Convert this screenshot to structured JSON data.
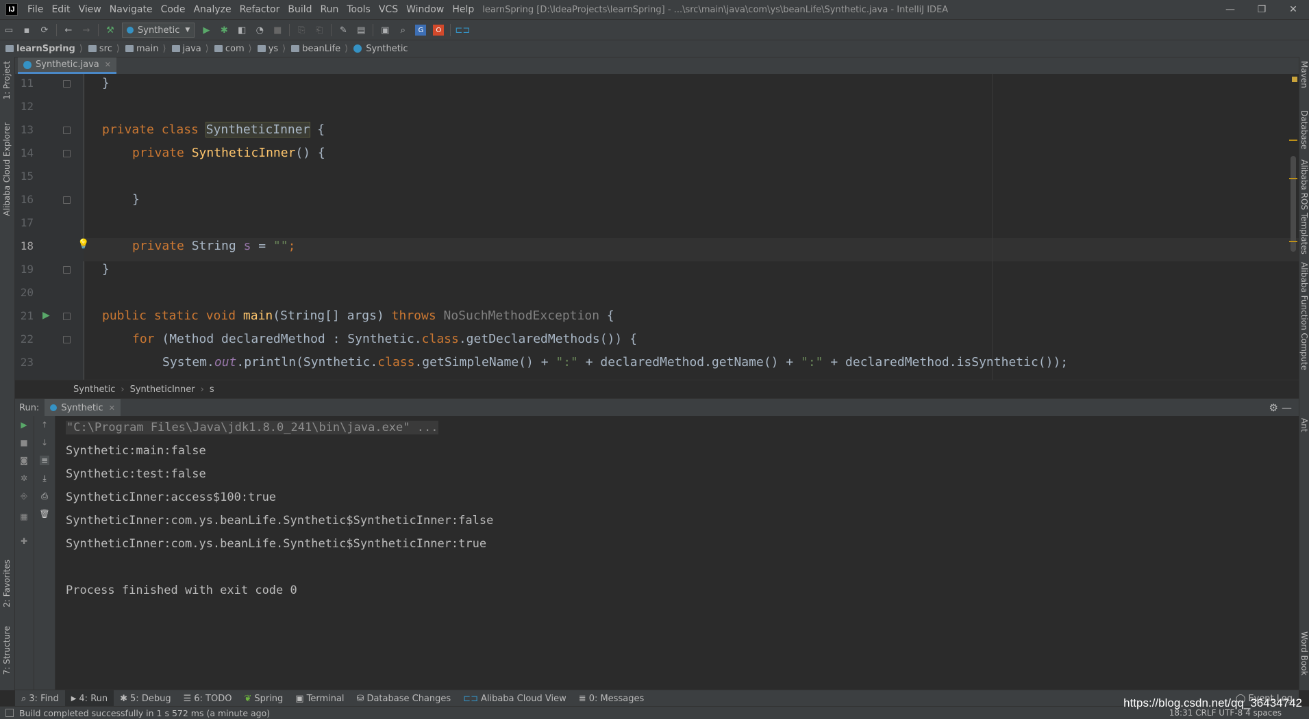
{
  "window": {
    "app_icon": "IJ",
    "menu": [
      "File",
      "Edit",
      "View",
      "Navigate",
      "Code",
      "Analyze",
      "Refactor",
      "Build",
      "Run",
      "Tools",
      "VCS",
      "Window",
      "Help"
    ],
    "title": "learnSpring [D:\\IdeaProjects\\learnSpring] - ...\\src\\main\\java\\com\\ys\\beanLife\\Synthetic.java - IntelliJ IDEA",
    "controls": [
      "—",
      "❐",
      "✕"
    ]
  },
  "toolbar": {
    "run_config": "Synthetic",
    "icons": [
      "open-icon",
      "save-icon",
      "sync-icon",
      "back-icon",
      "forward-icon",
      "build-icon",
      "run-icon",
      "debug-icon",
      "coverage-icon",
      "profile-icon",
      "stop-icon",
      "search-icon"
    ]
  },
  "breadcrumb": [
    "learnSpring",
    "src",
    "main",
    "java",
    "com",
    "ys",
    "beanLife",
    "Synthetic"
  ],
  "left_stripe": {
    "project": "1: Project",
    "cloud": "Alibaba Cloud Explorer",
    "favorites": "2: Favorites",
    "structure": "7: Structure"
  },
  "right_stripe": {
    "maven": "Maven",
    "database": "Database",
    "ros": "Alibaba ROS Templates",
    "function": "Alibaba Function Compute",
    "ant": "Ant",
    "wordbook": "Word Book"
  },
  "editor": {
    "tab": "Synthetic.java",
    "line_numbers": [
      "11",
      "12",
      "13",
      "14",
      "15",
      "16",
      "17",
      "18",
      "19",
      "20",
      "21",
      "22",
      "23"
    ]
  },
  "code": {
    "l11": "}",
    "l13_kw": "private class ",
    "l13_name": "SyntheticInner",
    "l13_rest": " {",
    "l14_kw": "private ",
    "l14_fn": "SyntheticInner",
    "l14_rest": "() {",
    "l16": "}",
    "l18_kw": "private ",
    "l18_type": "String ",
    "l18_var": "s",
    "l18_eq": " = ",
    "l18_str": "\"\"",
    "l18_end": ";",
    "l19": "}",
    "l21_kw": "public static void ",
    "l21_fn": "main",
    "l21_args": "(String[] args) ",
    "l21_throws": "throws ",
    "l21_exc": "NoSuchMethodException",
    "l21_end": " {",
    "l22_for": "for ",
    "l22_a": "(Method declaredMethod : Synthetic.",
    "l22_class": "class",
    "l22_b": ".getDeclaredMethods()) {",
    "l23_a": "System.",
    "l23_out": "out",
    "l23_b": ".println(Synthetic.",
    "l23_class": "class",
    "l23_c": ".getSimpleName() + ",
    "l23_s1": "\":\"",
    "l23_d": " + declaredMethod.getName() + ",
    "l23_s2": "\":\"",
    "l23_e": " + declaredMethod.isSynthetic());"
  },
  "editor_crumb": [
    "Synthetic",
    "SyntheticInner",
    "s"
  ],
  "run": {
    "label": "Run:",
    "tab": "Synthetic",
    "output": [
      "\"C:\\Program Files\\Java\\jdk1.8.0_241\\bin\\java.exe\" ...",
      "Synthetic:main:false",
      "Synthetic:test:false",
      "SyntheticInner:access$100:true",
      "SyntheticInner:com.ys.beanLife.Synthetic$SyntheticInner:false",
      "SyntheticInner:com.ys.beanLife.Synthetic$SyntheticInner:true",
      "",
      "Process finished with exit code 0"
    ]
  },
  "bottom_tabs": [
    "3: Find",
    "4: Run",
    "5: Debug",
    "6: TODO",
    "Spring",
    "Terminal",
    "Database Changes",
    "Alibaba Cloud View",
    "0: Messages"
  ],
  "event_log": "Event Log",
  "status": {
    "message": "Build completed successfully in 1 s 572 ms (a minute ago)",
    "right": "18:31   CRLF   UTF-8   4 spaces",
    "watermark": "https://blog.csdn.net/qq_36434742"
  }
}
